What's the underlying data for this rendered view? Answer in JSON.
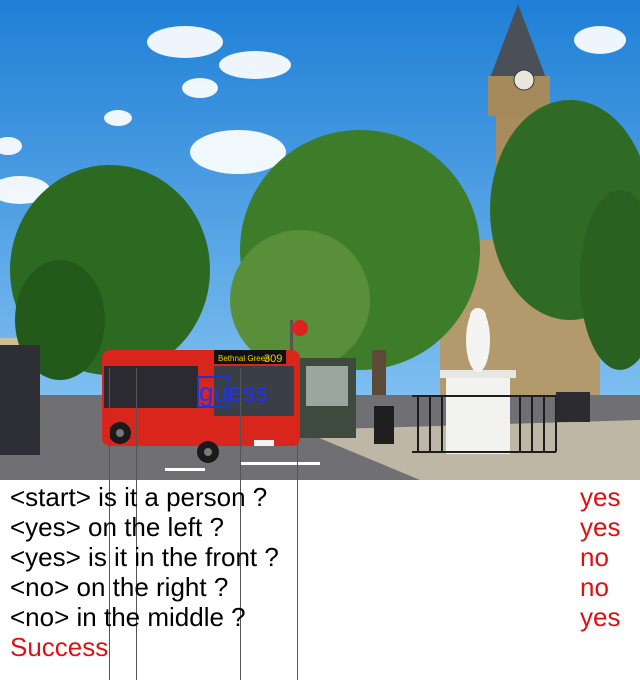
{
  "scene": {
    "bus_route_number": "309",
    "bus_destination": "Bethnal Green"
  },
  "guess_label": "guess",
  "dialogue": [
    {
      "question": "<start> is it a person ?",
      "answer": "yes"
    },
    {
      "question": "<yes> on the left ?",
      "answer": "yes"
    },
    {
      "question": "<yes> is it in the front ?",
      "answer": "no"
    },
    {
      "question": "<no> on the right ?",
      "answer": "no"
    },
    {
      "question": "<no> in the middle ?",
      "answer": "yes"
    }
  ],
  "result": "Success",
  "colors": {
    "answer": "#dd1111",
    "guess": "#2233ee",
    "bus": "#d9261c",
    "sky": "#2f8ee0"
  }
}
